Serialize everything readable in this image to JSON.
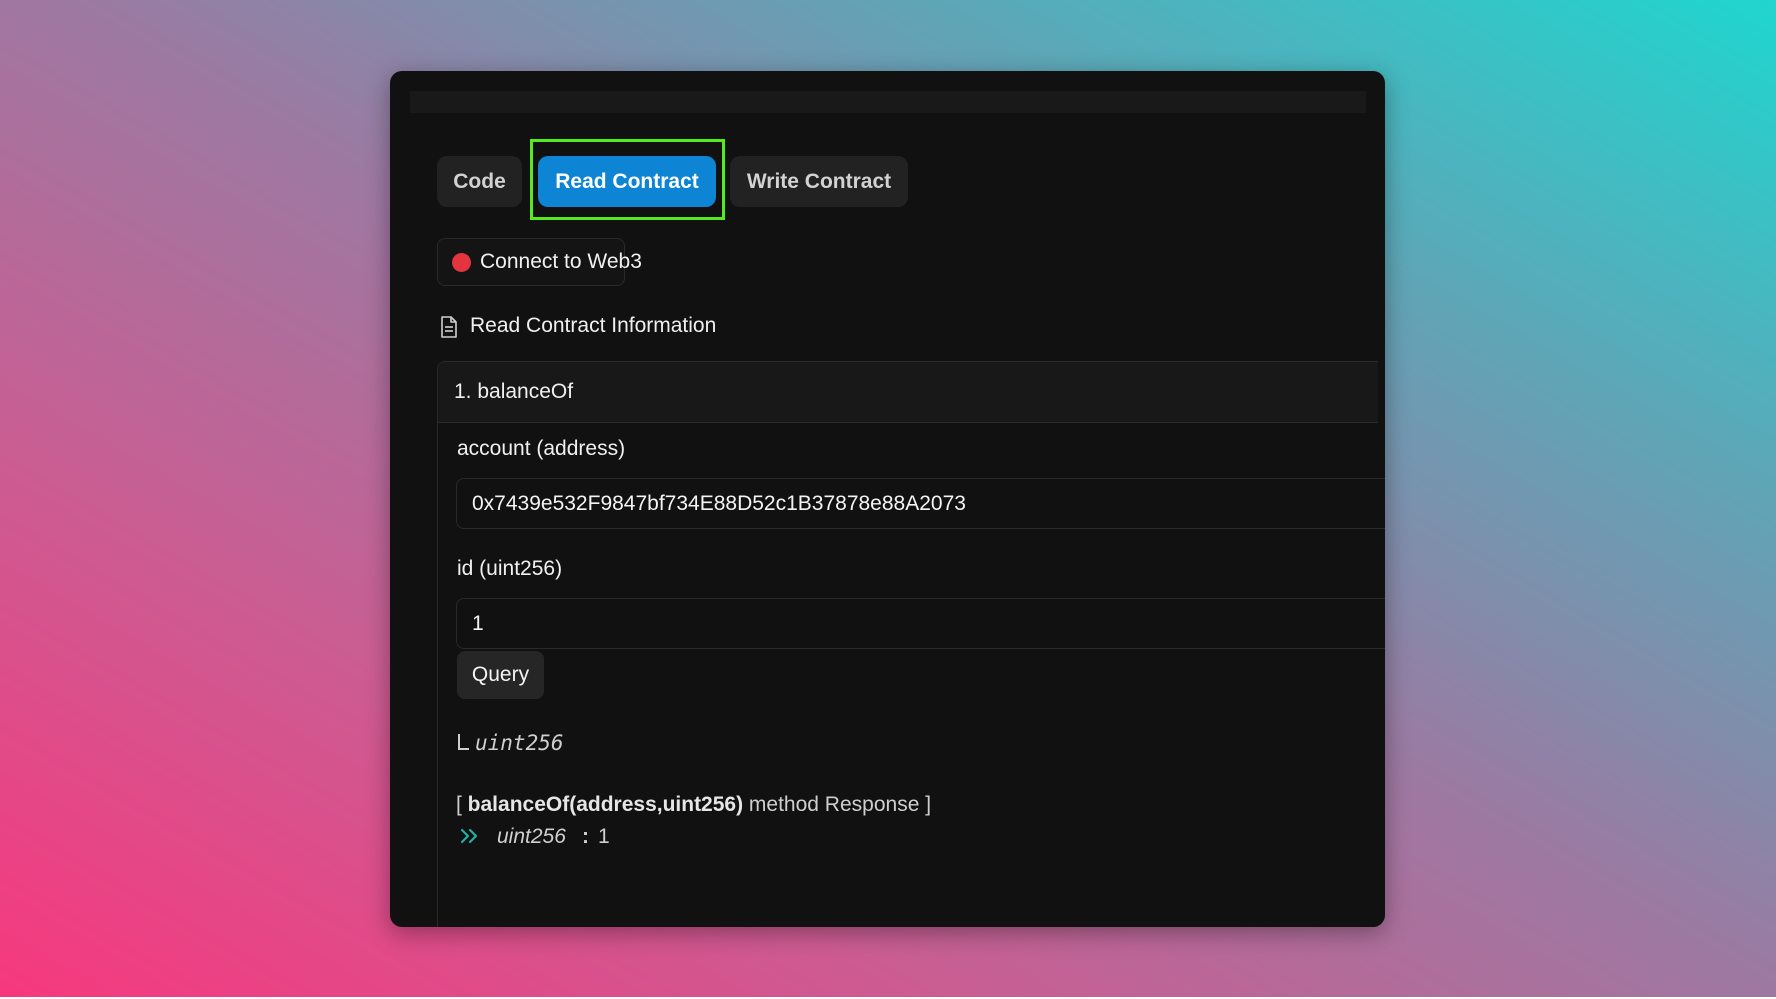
{
  "tabs": [
    {
      "label": "Code",
      "active": false
    },
    {
      "label": "Read Contract",
      "active": true
    },
    {
      "label": "Write Contract",
      "active": false
    }
  ],
  "connect": {
    "label": "Connect to Web3",
    "status_color": "#e3343f"
  },
  "section": {
    "title": "Read Contract Information",
    "icon": "document-icon"
  },
  "method": {
    "title": "1. balanceOf",
    "inputs": [
      {
        "label": "account (address)",
        "value": "0x7439e532F9847bf734E88D52c1B37878e88A2073"
      },
      {
        "label": "id (uint256)",
        "value": "1"
      }
    ],
    "query_label": "Query",
    "return_type": "uint256",
    "response": {
      "open": "[ ",
      "signature": "balanceOf(address,uint256)",
      "suffix": " method Response ]",
      "result_type": "uint256",
      "colon": ":",
      "result_value": "1"
    }
  },
  "colors": {
    "accent": "#0d85d4",
    "highlight": "#55e91f",
    "chevron": "#22b0a0"
  }
}
